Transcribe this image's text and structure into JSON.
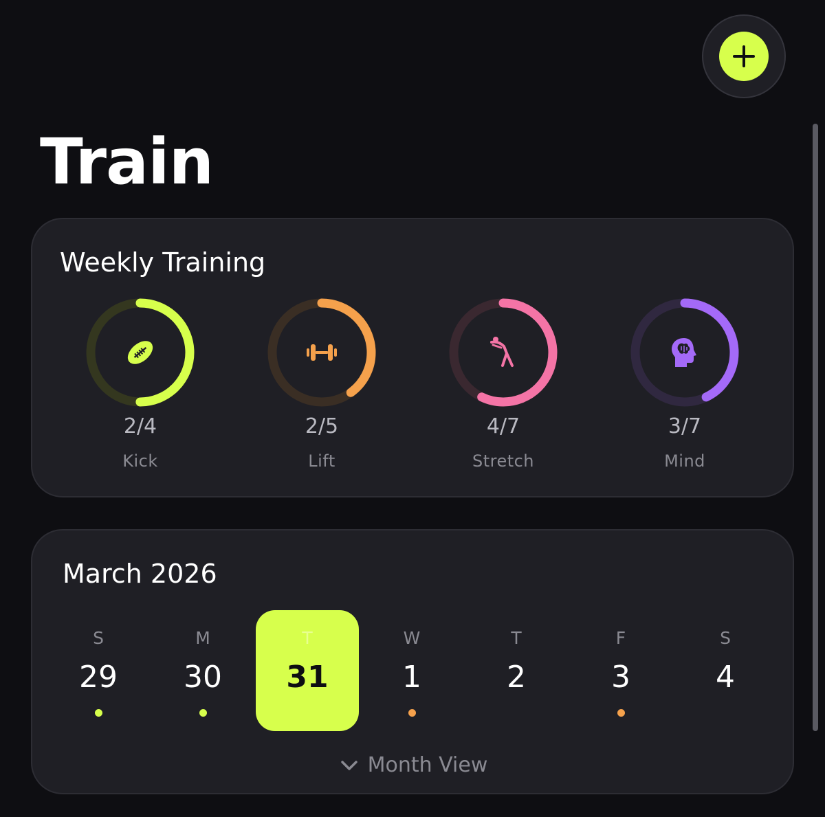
{
  "page": {
    "title": "Train"
  },
  "header": {
    "add_button_icon": "plus-icon",
    "accent_color": "#d7ff4c"
  },
  "weekly": {
    "title": "Weekly Training",
    "items": [
      {
        "label": "Kick",
        "count": "2/4",
        "done": 2,
        "total": 4,
        "color": "#d7ff4c",
        "track": "#34371f",
        "icon": "football-icon"
      },
      {
        "label": "Lift",
        "count": "2/5",
        "done": 2,
        "total": 5,
        "color": "#f5a14c",
        "track": "#3a2e24",
        "icon": "dumbbell-icon"
      },
      {
        "label": "Stretch",
        "count": "4/7",
        "done": 4,
        "total": 7,
        "color": "#f474a6",
        "track": "#3a2830",
        "icon": "stretch-figure-icon"
      },
      {
        "label": "Mind",
        "count": "3/7",
        "done": 3,
        "total": 7,
        "color": "#a46af8",
        "track": "#302840",
        "icon": "brain-head-icon"
      }
    ]
  },
  "calendar": {
    "title": "March 2026",
    "days": [
      {
        "letter": "S",
        "num": "29",
        "dot": "#d7ff4c",
        "selected": false
      },
      {
        "letter": "M",
        "num": "30",
        "dot": "#d7ff4c",
        "selected": false
      },
      {
        "letter": "T",
        "num": "31",
        "dot": "",
        "selected": true
      },
      {
        "letter": "W",
        "num": "1",
        "dot": "#f5a14c",
        "selected": false
      },
      {
        "letter": "T",
        "num": "2",
        "dot": "",
        "selected": false
      },
      {
        "letter": "F",
        "num": "3",
        "dot": "#f5a14c",
        "selected": false
      },
      {
        "letter": "S",
        "num": "4",
        "dot": "",
        "selected": false
      }
    ],
    "month_view_label": "Month View",
    "month_view_icon": "chevron-down-icon"
  }
}
